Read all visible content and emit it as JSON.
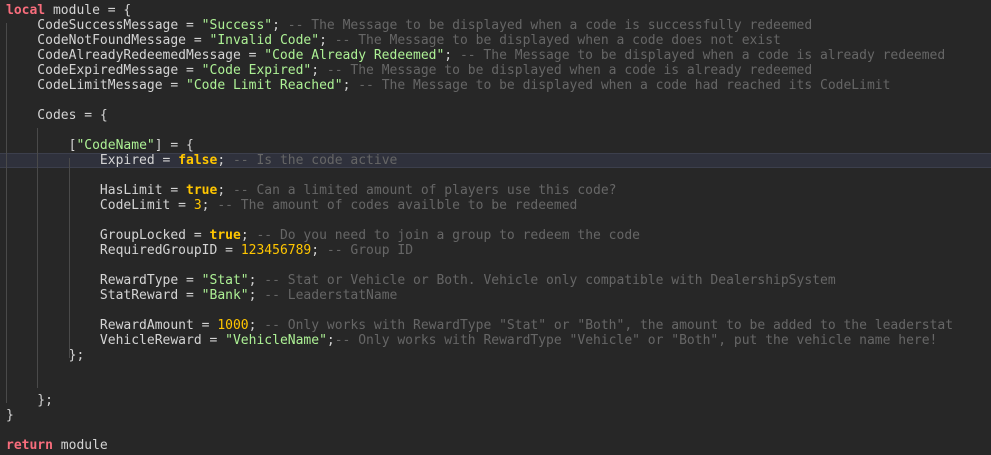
{
  "editor": {
    "lines": [
      [
        {
          "t": "kw",
          "v": "local"
        },
        {
          "t": "txt",
          "v": " module = {"
        }
      ],
      [
        {
          "t": "txt",
          "v": "    CodeSuccessMessage = "
        },
        {
          "t": "str",
          "v": "\"Success\""
        },
        {
          "t": "txt",
          "v": "; "
        },
        {
          "t": "com",
          "v": "-- The Message to be displayed when a code is successfully redeemed"
        }
      ],
      [
        {
          "t": "txt",
          "v": "    CodeNotFoundMessage = "
        },
        {
          "t": "str",
          "v": "\"Invalid Code\""
        },
        {
          "t": "txt",
          "v": "; "
        },
        {
          "t": "com",
          "v": "-- The Message to be displayed when a code does not exist"
        }
      ],
      [
        {
          "t": "txt",
          "v": "    CodeAlreadyRedeemedMessage = "
        },
        {
          "t": "str",
          "v": "\"Code Already Redeemed\""
        },
        {
          "t": "txt",
          "v": "; "
        },
        {
          "t": "com",
          "v": "-- The Message to be displayed when a code is already redeemed"
        }
      ],
      [
        {
          "t": "txt",
          "v": "    CodeExpiredMessage = "
        },
        {
          "t": "str",
          "v": "\"Code Expired\""
        },
        {
          "t": "txt",
          "v": "; "
        },
        {
          "t": "com",
          "v": "-- The Message to be displayed when a code is already redeemed"
        }
      ],
      [
        {
          "t": "txt",
          "v": "    CodeLimitMessage = "
        },
        {
          "t": "str",
          "v": "\"Code Limit Reached\""
        },
        {
          "t": "txt",
          "v": "; "
        },
        {
          "t": "com",
          "v": "-- The Message to be displayed when a code had reached its CodeLimit"
        }
      ],
      [],
      [
        {
          "t": "txt",
          "v": "    Codes = {"
        }
      ],
      [],
      [
        {
          "t": "txt",
          "v": "        ["
        },
        {
          "t": "str",
          "v": "\"CodeName\""
        },
        {
          "t": "txt",
          "v": "] = {"
        }
      ],
      [
        {
          "t": "txt",
          "v": "            Expired = "
        },
        {
          "t": "bool",
          "v": "false"
        },
        {
          "t": "txt",
          "v": "; "
        },
        {
          "t": "com",
          "v": "-- Is the code active"
        }
      ],
      [],
      [
        {
          "t": "txt",
          "v": "            HasLimit = "
        },
        {
          "t": "bool",
          "v": "true"
        },
        {
          "t": "txt",
          "v": "; "
        },
        {
          "t": "com",
          "v": "-- Can a limited amount of players use this code?"
        }
      ],
      [
        {
          "t": "txt",
          "v": "            CodeLimit = "
        },
        {
          "t": "num",
          "v": "3"
        },
        {
          "t": "txt",
          "v": "; "
        },
        {
          "t": "com",
          "v": "-- The amount of codes availble to be redeemed"
        }
      ],
      [],
      [
        {
          "t": "txt",
          "v": "            GroupLocked = "
        },
        {
          "t": "bool",
          "v": "true"
        },
        {
          "t": "txt",
          "v": "; "
        },
        {
          "t": "com",
          "v": "-- Do you need to join a group to redeem the code"
        }
      ],
      [
        {
          "t": "txt",
          "v": "            RequiredGroupID = "
        },
        {
          "t": "num",
          "v": "123456789"
        },
        {
          "t": "txt",
          "v": "; "
        },
        {
          "t": "com",
          "v": "-- Group ID"
        }
      ],
      [],
      [
        {
          "t": "txt",
          "v": "            RewardType = "
        },
        {
          "t": "str",
          "v": "\"Stat\""
        },
        {
          "t": "txt",
          "v": "; "
        },
        {
          "t": "com",
          "v": "-- Stat or Vehicle or Both. Vehicle only compatible with DealershipSystem"
        }
      ],
      [
        {
          "t": "txt",
          "v": "            StatReward = "
        },
        {
          "t": "str",
          "v": "\"Bank\""
        },
        {
          "t": "txt",
          "v": "; "
        },
        {
          "t": "com",
          "v": "-- LeaderstatName"
        }
      ],
      [],
      [
        {
          "t": "txt",
          "v": "            RewardAmount = "
        },
        {
          "t": "num",
          "v": "1000"
        },
        {
          "t": "txt",
          "v": "; "
        },
        {
          "t": "com",
          "v": "-- Only works with RewardType \"Stat\" or \"Both\", the amount to be added to the leaderstat"
        }
      ],
      [
        {
          "t": "txt",
          "v": "            VehicleReward = "
        },
        {
          "t": "str",
          "v": "\"VehicleName\""
        },
        {
          "t": "txt",
          "v": ";"
        },
        {
          "t": "com",
          "v": "-- Only works with RewardType \"Vehicle\" or \"Both\", put the vehicle name here!"
        }
      ],
      [
        {
          "t": "txt",
          "v": "        };"
        }
      ],
      [],
      [],
      [
        {
          "t": "txt",
          "v": "    };"
        }
      ],
      [
        {
          "t": "txt",
          "v": "}"
        }
      ],
      [],
      [
        {
          "t": "kw",
          "v": "return"
        },
        {
          "t": "txt",
          "v": " module"
        }
      ]
    ],
    "current_line": 10
  }
}
